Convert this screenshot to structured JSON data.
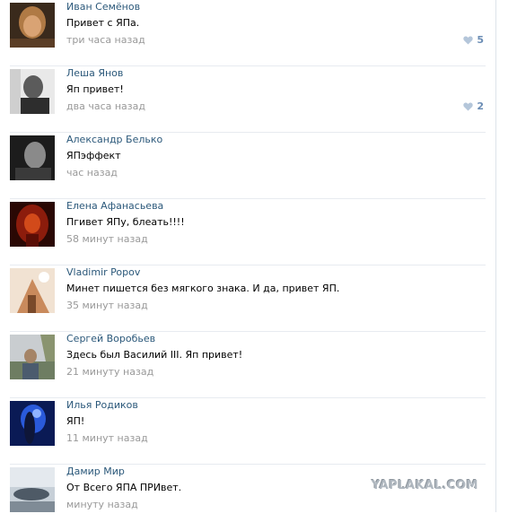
{
  "comments": [
    {
      "name": "Иван Семёнов",
      "text": "Привет с ЯПа.",
      "time": "три часа назад",
      "likes": "5"
    },
    {
      "name": "Леша Янов",
      "text": "Яп привет!",
      "time": "два часа назад",
      "likes": "2"
    },
    {
      "name": "Александр Белько",
      "text": "ЯПэффект",
      "time": "час назад",
      "likes": ""
    },
    {
      "name": "Елена Афанасьева",
      "text": "Пгивет ЯПу, блеать!!!!",
      "time": "58 минут назад",
      "likes": ""
    },
    {
      "name": "Vladimir Popov",
      "text": "Минет пишется без мягкого знака. И да, привет ЯП.",
      "time": "35 минут назад",
      "likes": ""
    },
    {
      "name": "Сергей Воробьев",
      "text": "Здесь был Василий III. Яп привет!",
      "time": "21 минуту назад",
      "likes": ""
    },
    {
      "name": "Илья Родиков",
      "text": "ЯП!",
      "time": "11 минут назад",
      "likes": ""
    },
    {
      "name": "Дамир Мир",
      "text": "От Всего ЯПА ПРИвет.",
      "time": "минуту назад",
      "likes": ""
    }
  ],
  "watermark": "YAPLAKAL.COM",
  "colors": {
    "name_link": "#2b587a",
    "time": "#999999",
    "like": "#6b8db5"
  }
}
